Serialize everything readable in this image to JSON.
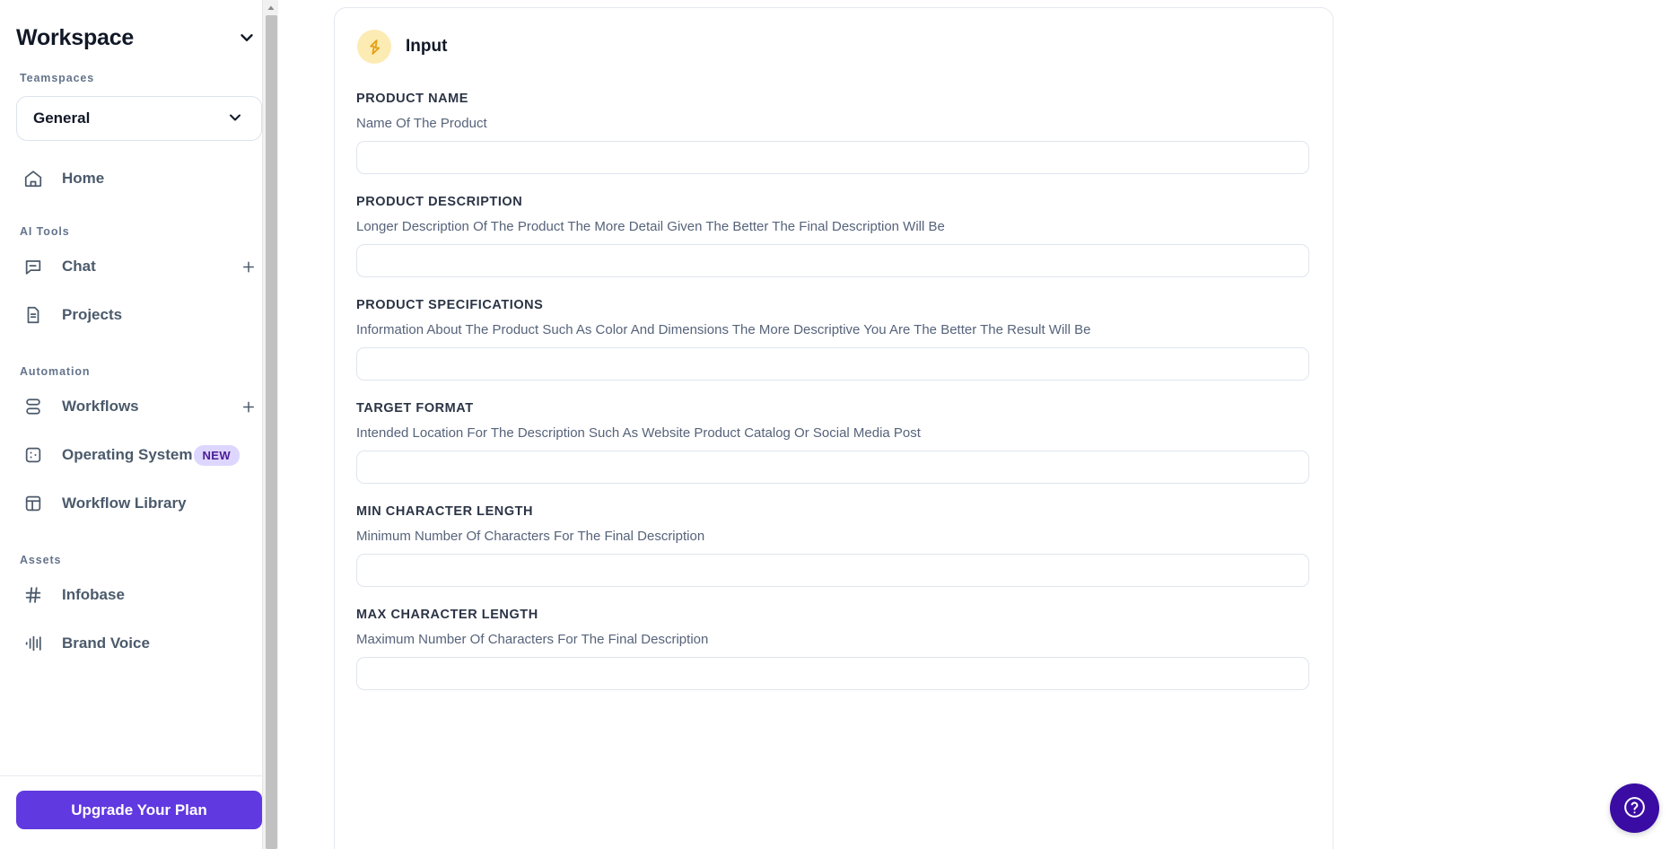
{
  "sidebar": {
    "workspace_title": "Workspace",
    "workspace_chevron_icon": "chevron-down-icon",
    "teamspaces_label": "Teamspaces",
    "teamspace_selected": "General",
    "teamspace_chevron_icon": "chevron-down-icon",
    "sections": [
      {
        "label": "",
        "items": [
          {
            "label": "Home",
            "icon": "home-icon",
            "plus": false,
            "badge": ""
          }
        ]
      },
      {
        "label": "AI Tools",
        "items": [
          {
            "label": "Chat",
            "icon": "chat-bubble-icon",
            "plus": true,
            "badge": ""
          },
          {
            "label": "Projects",
            "icon": "document-icon",
            "plus": false,
            "badge": ""
          }
        ]
      },
      {
        "label": "Automation",
        "items": [
          {
            "label": "Workflows",
            "icon": "workflows-icon",
            "plus": true,
            "badge": ""
          },
          {
            "label": "Operating System",
            "icon": "operating-system-icon",
            "plus": false,
            "badge": "NEW"
          },
          {
            "label": "Workflow Library",
            "icon": "library-layout-icon",
            "plus": false,
            "badge": ""
          }
        ]
      },
      {
        "label": "Assets",
        "items": [
          {
            "label": "Infobase",
            "icon": "hash-icon",
            "plus": false,
            "badge": ""
          },
          {
            "label": "Brand Voice",
            "icon": "audio-waveform-icon",
            "plus": false,
            "badge": ""
          }
        ]
      }
    ],
    "upgrade_label": "Upgrade Your Plan",
    "scrollbar": {
      "up_arrow_icon": "scroll-up-arrow-icon"
    }
  },
  "main": {
    "card_title": "Input",
    "card_icon": "lightning-bolt-icon",
    "fields": [
      {
        "label": "PRODUCT NAME",
        "help": "Name Of The Product",
        "value": "",
        "placeholder": ""
      },
      {
        "label": "PRODUCT DESCRIPTION",
        "help": "Longer Description Of The Product The More Detail Given The Better The Final Description Will Be",
        "value": "",
        "placeholder": ""
      },
      {
        "label": "PRODUCT SPECIFICATIONS",
        "help": "Information About The Product Such As Color And Dimensions The More Descriptive You Are The Better The Result Will Be",
        "value": "",
        "placeholder": ""
      },
      {
        "label": "TARGET FORMAT",
        "help": "Intended Location For The Description Such As Website Product Catalog Or Social Media Post",
        "value": "",
        "placeholder": ""
      },
      {
        "label": "MIN CHARACTER LENGTH",
        "help": "Minimum Number Of Characters For The Final Description",
        "value": "",
        "placeholder": ""
      },
      {
        "label": "MAX CHARACTER LENGTH",
        "help": "Maximum Number Of Characters For The Final Description",
        "value": "",
        "placeholder": ""
      }
    ],
    "help_button_icon": "question-mark-circle-icon"
  },
  "colors": {
    "accent_purple": "#6039e0",
    "badge_bg": "#ddd6fe",
    "badge_text": "#4c1d95",
    "bolt_bg": "#fdebb4",
    "bolt_fg": "#e5a117",
    "help_fab": "#3a0ca3"
  }
}
